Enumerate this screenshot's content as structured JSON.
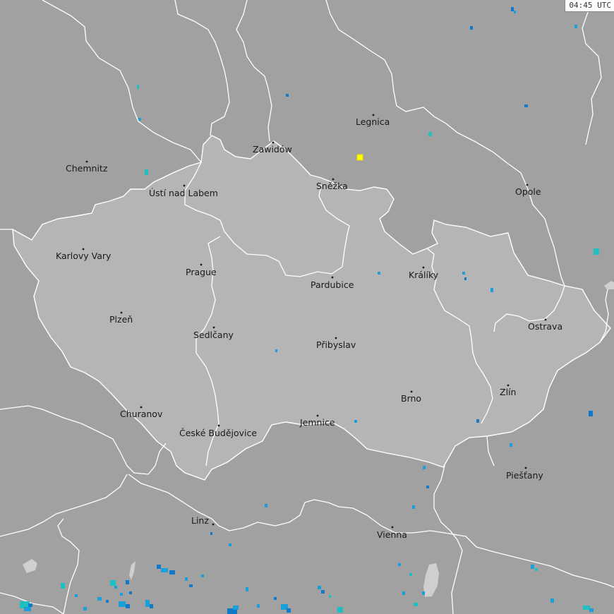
{
  "timestamp": "04:45 UTC",
  "colors": {
    "background": "#a1a1a1",
    "country_fill": "#b5b5b5",
    "border_line": "#ffffff",
    "rain_light": "#1aa0d8",
    "rain_medium": "#1278c8",
    "rain_cyan": "#20c0c0",
    "lightning_marker": "#ffff00",
    "lake": "#cfcfcf"
  },
  "cities": [
    {
      "id": "legnica",
      "name": "Legnica"
    },
    {
      "id": "zawidow",
      "name": "Zawidów"
    },
    {
      "id": "chemnitz",
      "name": "Chemnitz"
    },
    {
      "id": "snezka",
      "name": "Sněžka"
    },
    {
      "id": "opole",
      "name": "Opole"
    },
    {
      "id": "usti-nad-labem",
      "name": "Ústí nad Labem"
    },
    {
      "id": "karlovy-vary",
      "name": "Karlovy Vary"
    },
    {
      "id": "prague",
      "name": "Prague"
    },
    {
      "id": "kraliky",
      "name": "Králíky"
    },
    {
      "id": "pardubice",
      "name": "Pardubice"
    },
    {
      "id": "plzen",
      "name": "Plzeň"
    },
    {
      "id": "ostrava",
      "name": "Ostrava"
    },
    {
      "id": "sedlcany",
      "name": "Sedlčany"
    },
    {
      "id": "pribyslav",
      "name": "Přibyslav"
    },
    {
      "id": "zlin",
      "name": "Zlín"
    },
    {
      "id": "brno",
      "name": "Brno"
    },
    {
      "id": "churanov",
      "name": "Churanov"
    },
    {
      "id": "jemnice",
      "name": "Jemnice"
    },
    {
      "id": "ceske-budejovice",
      "name": "České Budějovice"
    },
    {
      "id": "piestany",
      "name": "Piešťany"
    },
    {
      "id": "linz",
      "name": "Linz"
    },
    {
      "id": "vienna",
      "name": "Vienna"
    }
  ]
}
